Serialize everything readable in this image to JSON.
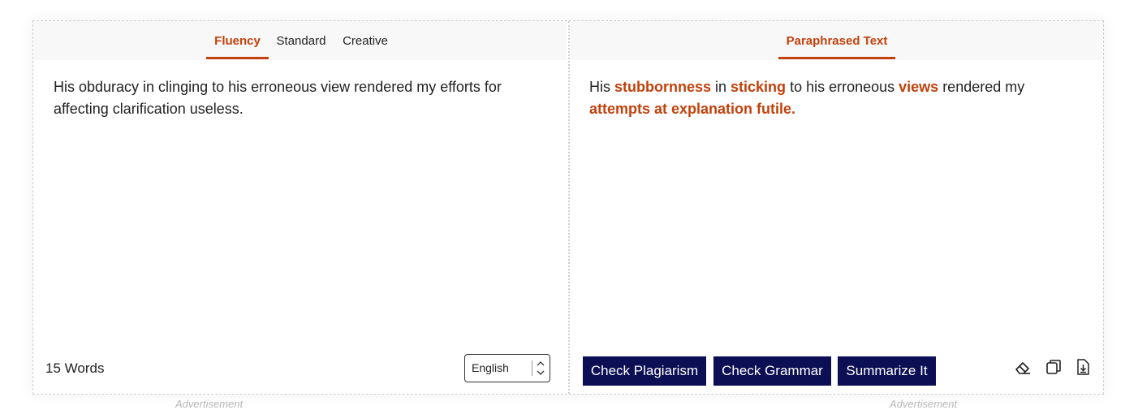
{
  "left_panel": {
    "tabs": [
      {
        "label": "Fluency",
        "active": true
      },
      {
        "label": "Standard",
        "active": false
      },
      {
        "label": "Creative",
        "active": false
      }
    ],
    "input_text": "His obduracy in clinging to his erroneous view rendered my efforts for affecting clarification useless.",
    "word_count": "15 Words",
    "language": "English"
  },
  "right_panel": {
    "tab_label": "Paraphrased Text",
    "output_segments": [
      {
        "text": "His ",
        "changed": false
      },
      {
        "text": "stubbornness",
        "changed": true
      },
      {
        "text": " in ",
        "changed": false
      },
      {
        "text": "sticking",
        "changed": true
      },
      {
        "text": " to his erroneous ",
        "changed": false
      },
      {
        "text": "views",
        "changed": true
      },
      {
        "text": " rendered my ",
        "changed": false
      },
      {
        "text": "attempts at explanation futile.",
        "changed": true
      }
    ],
    "buttons": {
      "check_plagiarism": "Check Plagiarism",
      "check_grammar": "Check Grammar",
      "summarize": "Summarize It"
    },
    "icons": [
      "eraser-icon",
      "copy-icon",
      "download-icon"
    ]
  },
  "ads": {
    "left": "Advertisement",
    "right": "Advertisement"
  },
  "colors": {
    "accent": "#c2410c",
    "button_bg": "#0c0f54",
    "tab_bar_bg": "#f8f8f8"
  }
}
